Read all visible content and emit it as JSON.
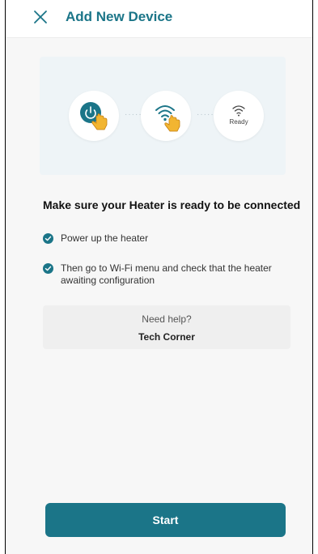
{
  "header": {
    "title": "Add New Device",
    "close_icon": "close-icon"
  },
  "illustration": {
    "steps": [
      {
        "icon": "power-icon"
      },
      {
        "icon": "wifi-icon"
      },
      {
        "icon": "wifi-icon",
        "label": "Ready"
      }
    ],
    "connector": "·····"
  },
  "instructions": {
    "title": "Make sure your Heater is ready to be connected",
    "items": [
      "Power up the heater",
      "Then go to Wi-Fi menu and check that the heater awaiting configuration"
    ]
  },
  "help": {
    "question": "Need help?",
    "link": "Tech Corner"
  },
  "actions": {
    "start_label": "Start"
  },
  "colors": {
    "accent": "#1b7588",
    "hand": "#f2b531"
  }
}
